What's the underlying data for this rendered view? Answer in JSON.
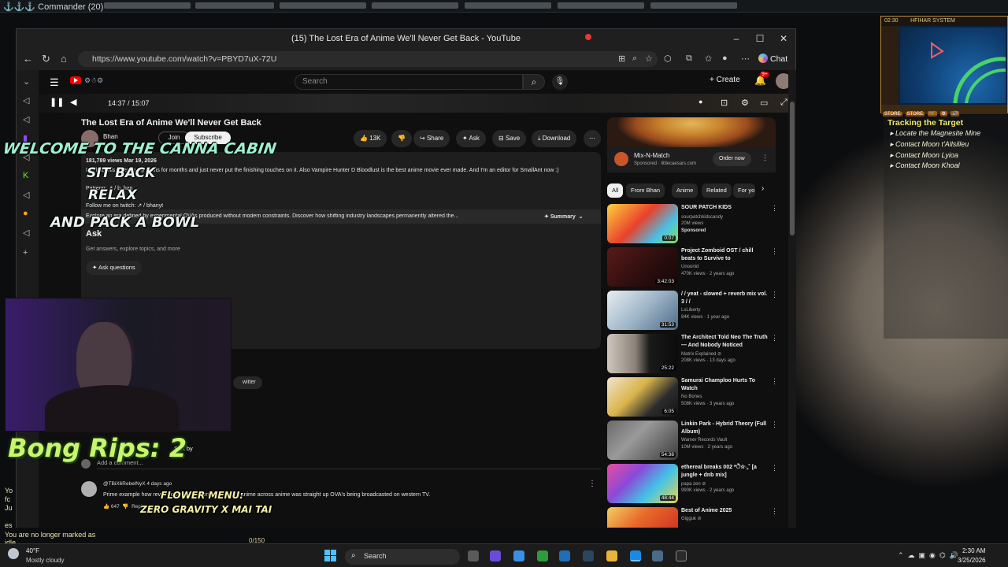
{
  "game": {
    "title": "⚓⚓⚓ Commander (20)",
    "minimap_title": "HFIHAR SYSTEM",
    "minimap_time": "02:30",
    "minimap_tabs": [
      "STORE",
      "STORE",
      "🛒",
      "⚙",
      "🔊"
    ],
    "quest_title": "Tracking the Target",
    "quests": [
      "Locate the Magnesite Mine",
      "Contact Moon t'Allsilleu",
      "Contact Moon Lyioa",
      "Contact Moon Khoal"
    ],
    "log_lines": [
      "Yo",
      "fc",
      "Ju",
      "es",
      "You are no longer marked as",
      "idle"
    ],
    "ammo": "0/150"
  },
  "browser": {
    "window_title": "(15) The Lost Era of Anime We'll Never Get Back - YouTube",
    "url": "https://www.youtube.com/watch?v=PBYD7uX-72U",
    "chat_label": "Chat"
  },
  "youtube": {
    "search_placeholder": "Search",
    "create_label": "Create",
    "notif_count": "9+",
    "timecode": "14:37 / 15:07",
    "video_title": "The Lost Era of Anime We'll Never Get Back",
    "channel": "Bhan",
    "join": "Join",
    "subscribe": "Subscribe",
    "likes": "13K",
    "share": "Share",
    "ask": "Ask",
    "save": "Save",
    "download": "Download",
    "desc_meta": "181,789 views  Mar 19, 2026",
    "desc_line1": "I've had this video in my drafts for months and just never put the finishing touches on it. Also Vampire Hunter D Bloodlust is the best anime movie ever made. And I'm an editor for SmallAnt now :)",
    "desc_patreon": "Patreon:  ↗ / b_han",
    "desc_follow": "Follow me on twitch:  ↗ / bhanyt",
    "ai_summary": "Explore an era defined by experimental OVAs produced without modern constraints. Discover how shifting industry landscapes permanently altered the...",
    "summary_btn": "Summary",
    "ask_title": "Ask",
    "ask_sub": "Get answers, explore topics, and more",
    "ask_questions": "Ask questions",
    "twitter": "witter",
    "sort_by": "Sort by",
    "add_comment": "Add a comment...",
    "comment_user": "@TBiX6RebelNyX  4 days ago",
    "comment_text": "Prime example how revolutionary and even mainstream anime across anime was straight up OVA's being broadcasted on western TV.",
    "comment_likes": "647",
    "comment_reply": "Reply",
    "ad": {
      "name": "Mix-N-Match",
      "sponsor": "Sponsored · littlecaesars.com",
      "cta": "Order now"
    },
    "chips": [
      "All",
      "From Bhan",
      "Anime",
      "Related",
      "For yo"
    ],
    "recs": [
      {
        "title": "SOUR PATCH KIDS",
        "channel": "sourpatchkidscandy",
        "meta": "20M views",
        "extra": "Sponsored",
        "dur": "0:07"
      },
      {
        "title": "Project Zomboid OST / chill beats to Survive to",
        "channel": "Unoonid",
        "meta": "470K views · 2 years ago",
        "extra": "",
        "dur": "3:42:03"
      },
      {
        "title": "/ / yeat - slowed + reverb mix vol. 3 / /",
        "channel": "LxLiberty",
        "meta": "84K views · 1 year ago",
        "extra": "",
        "dur": "31:53"
      },
      {
        "title": "The Architect Told Neo The Truth — And Nobody Noticed",
        "channel": "Matrix Explained ⊘",
        "meta": "208K views · 13 days ago",
        "extra": "",
        "dur": "25:22"
      },
      {
        "title": "Samurai Champloo Hurts To Watch",
        "channel": "No Bones",
        "meta": "508K views · 3 years ago",
        "extra": "",
        "dur": "6:05"
      },
      {
        "title": "Linkin Park - Hybrid Theory (Full Album)",
        "channel": "Warner Records Vault",
        "meta": "10M views · 2 years ago",
        "extra": "",
        "dur": "54:38"
      },
      {
        "title": "ethereal breaks 002 *ੈ✩‧₊˚ [a jungle + dnb mix]",
        "channel": "papa zen ⊘",
        "meta": "990K views · 2 years ago",
        "extra": "",
        "dur": "48:44"
      },
      {
        "title": "Best of Anime 2025",
        "channel": "Gigguk ⊘",
        "meta": "",
        "extra": "",
        "dur": ""
      }
    ]
  },
  "overlay": {
    "welcome": "WELCOME TO THE CANNA CABIN",
    "sit_back": "SIT BACK",
    "relax": "RELAX",
    "pack": "AND PACK A BOWL",
    "bong": "Bong Rips: 2",
    "flower": "FLOWER MENU:",
    "strain": "ZERO GRAVITY X MAI TAI"
  },
  "taskbar": {
    "temp": "40°F",
    "weather": "Mostly cloudy",
    "search": "Search",
    "time": "2:30 AM",
    "date": "3/25/2026"
  }
}
